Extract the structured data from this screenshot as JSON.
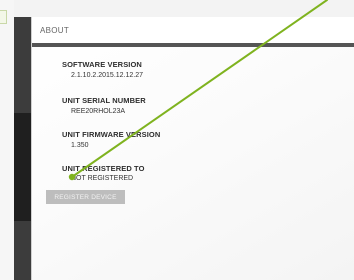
{
  "panel": {
    "title": "ABOUT"
  },
  "sections": [
    {
      "label": "SOFTWARE VERSION",
      "value": "2.1.10.2.2015.12.12.27"
    },
    {
      "label": "UNIT SERIAL NUMBER",
      "value": "REE20RHOL23A"
    },
    {
      "label": "UNIT FIRMWARE VERSION",
      "value": "1.350"
    },
    {
      "label": "UNIT REGISTERED TO",
      "value": "NOT REGISTERED"
    }
  ],
  "register_button": {
    "label": "REGISTER DEVICE"
  },
  "colors": {
    "sidebar_dark": "#3c3c3c",
    "header_rule": "#555555",
    "button_bg": "#bdbdbd",
    "annotation_arrow": "#7fb31f"
  },
  "annotation": {
    "icon": "pointer-arrow-icon"
  }
}
